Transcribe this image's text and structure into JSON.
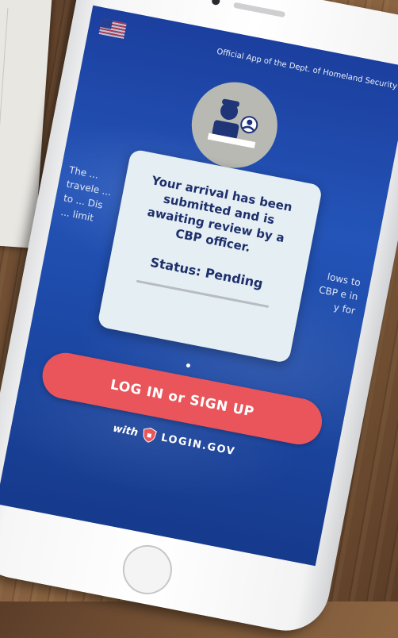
{
  "screen": {
    "official_text": "Official App of the Dept. of Homeland Security",
    "side_left_text": "The ... travele ... to ... Dis ... limit",
    "side_right_text": "lows to CBP e in y for",
    "dialog": {
      "message": "Your arrival has been submitted and is awaiting review by a CBP officer.",
      "status": "Status: Pending"
    },
    "login_button_label": "LOG IN or SIGN UP",
    "with_label": "with",
    "login_gov_label": "LOGIN.GOV"
  },
  "colors": {
    "screen_blue": "#2454b8",
    "button_red": "#e9555a",
    "dialog_bg": "#e4eef3",
    "dialog_text": "#1e2f6b"
  },
  "icons": [
    "us-flag-icon",
    "cbp-officer-emblem-icon",
    "login-gov-shield-icon"
  ]
}
